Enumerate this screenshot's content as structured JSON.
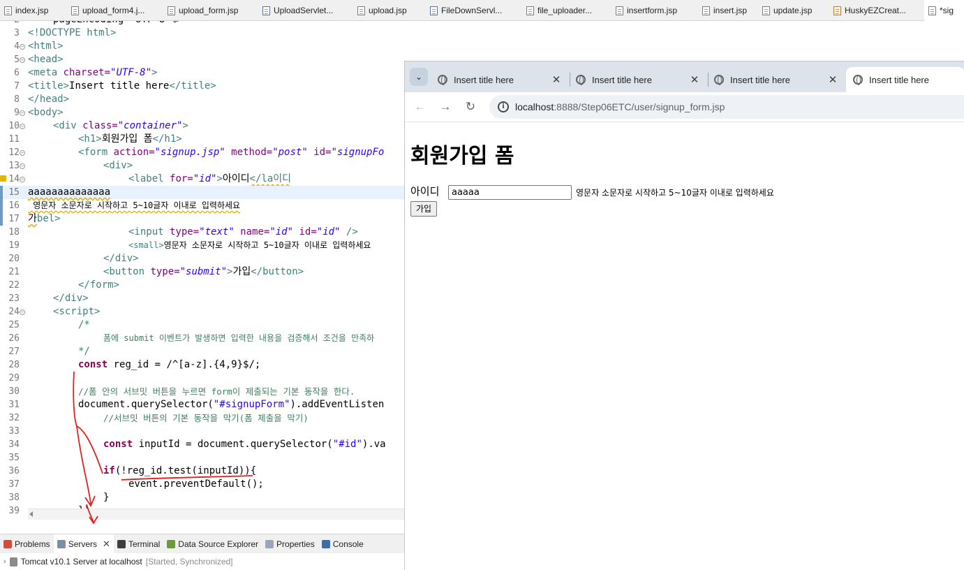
{
  "editor_tabs": [
    {
      "label": "index.jsp",
      "icon": "jsp-file-icon"
    },
    {
      "label": "upload_form4.j...",
      "icon": "jsp-file-icon"
    },
    {
      "label": "upload_form.jsp",
      "icon": "jsp-file-icon"
    },
    {
      "label": "UploadServlet...",
      "icon": "java-file-icon"
    },
    {
      "label": "upload.jsp",
      "icon": "jsp-file-icon"
    },
    {
      "label": "FileDownServl...",
      "icon": "java-file-icon"
    },
    {
      "label": "file_uploader...",
      "icon": "jsp-file-icon"
    },
    {
      "label": "insertform.jsp",
      "icon": "jsp-file-icon"
    },
    {
      "label": "insert.jsp",
      "icon": "jsp-file-icon"
    },
    {
      "label": "update.jsp",
      "icon": "jsp-file-icon"
    },
    {
      "label": "HuskyEZCreat...",
      "icon": "html-file-icon"
    },
    {
      "label": "*sig",
      "icon": "jsp-file-icon"
    }
  ],
  "code": {
    "line_numbers": [
      "2",
      "3",
      "4",
      "5",
      "6",
      "7",
      "8",
      "9",
      "10",
      "11",
      "12",
      "13",
      "14",
      "15",
      "16",
      "17",
      "18",
      "19",
      "20",
      "21",
      "22",
      "23",
      "24",
      "25",
      "26",
      "27",
      "28",
      "29",
      "30",
      "31",
      "32",
      "33",
      "34",
      "35",
      "36",
      "37",
      "38",
      "39"
    ],
    "l2": "pageEncoding=\"UTF-8\"%>",
    "l3": "<!DOCTYPE html>",
    "l4": "<html>",
    "l5": "<head>",
    "l6_tag": "<meta ",
    "l6_attr": "charset=",
    "l6_val": "\"UTF-8\"",
    "l6_end": ">",
    "l7_open": "<title>",
    "l7_text": "Insert title here",
    "l7_close": "</title>",
    "l8": "</head>",
    "l9": "<body>",
    "l10_tag": "<div ",
    "l10_attr": "class=",
    "l10_val": "\"container\"",
    "l10_end": ">",
    "l11_open": "<h1>",
    "l11_text": "회원가입 폼",
    "l11_close": "</h1>",
    "l12_tag": "<form ",
    "l12_attr1": "action=",
    "l12_val1": "\"signup.jsp\"",
    "l12_attr2": " method=",
    "l12_val2": "\"post\"",
    "l12_attr3": " id=",
    "l12_val3": "\"signupFo",
    "l13": "<div>",
    "l14_tag": "<label ",
    "l14_attr": "for=",
    "l14_val": "\"id\"",
    "l14_end": ">",
    "l14_text": "아이디",
    "l14_tail": "</la이디",
    "l15": "aaaaaaaaaaaaaa",
    "l16": " 영문자 소문자로 시작하고 5~10글자 이내로 입력하세요",
    "l17_a": "가",
    "l17_b": "bel>",
    "l18_tag": "<input ",
    "l18_attr1": "type=",
    "l18_val1": "\"text\"",
    "l18_attr2": " name=",
    "l18_val2": "\"id\"",
    "l18_attr3": " id=",
    "l18_val3": "\"id\"",
    "l18_end": " />",
    "l19_open": "<small>",
    "l19_text": "영문자 소문자로 시작하고 5~10글자 이내로 입력하세요",
    "l20": "</div>",
    "l21_tag": "<button ",
    "l21_attr": "type=",
    "l21_val": "\"submit\"",
    "l21_end": ">",
    "l21_text": "가입",
    "l21_close": "</button>",
    "l22": "</form>",
    "l23": "</div>",
    "l24": "<script>",
    "l25": "/*",
    "l26": "폼에 submit 이벤트가 발생하면 입력한 내용을 검증해서 조건을 만족하",
    "l27": "*/",
    "l28_kw": "const",
    "l28_rest": " reg_id = /^[a-z].{4,9}$/;",
    "l29": "",
    "l30": "//폼 안의 서브밋 버튼을 누르면 form이 제출되는 기본 동작을 한다.",
    "l31_a": "document.querySelector(",
    "l31_str": "\"#signupForm\"",
    "l31_b": ").addEventListen",
    "l32": "//서브밋 버튼의 기본 동작을 막기(폼 제출을 막기)",
    "l33": "",
    "l34_kw": "const",
    "l34_a": " inputId = document.querySelector(",
    "l34_str": "\"#id\"",
    "l34_b": ").va",
    "l35": "",
    "l36_kw": "if",
    "l36_rest": "(!reg_id.test(inputId)){",
    "l37": "event.preventDefault();",
    "l38": "}",
    "l39": "})"
  },
  "bottom_views": {
    "tabs": [
      {
        "label": "Problems",
        "icon": "problems-icon"
      },
      {
        "label": "Servers",
        "icon": "servers-icon",
        "close": "✕"
      },
      {
        "label": "Terminal",
        "icon": "terminal-icon"
      },
      {
        "label": "Data Source Explorer",
        "icon": "data-source-icon"
      },
      {
        "label": "Properties",
        "icon": "properties-icon"
      },
      {
        "label": "Console",
        "icon": "console-icon"
      }
    ],
    "server_name": "Tomcat v10.1 Server at localhost",
    "server_status": "[Started, Synchronized]"
  },
  "browser": {
    "tabs": [
      {
        "title": "Insert title here",
        "close": "✕"
      },
      {
        "title": "Insert title here",
        "close": "✕"
      },
      {
        "title": "Insert title here",
        "close": "✕"
      },
      {
        "title": "Insert title here",
        "close": ""
      }
    ],
    "url_host": "localhost",
    "url_rest": ":8888/Step06ETC/user/signup_form.jsp",
    "page": {
      "heading": "회원가입 폼",
      "id_label": "아이디",
      "id_value": "aaaaa",
      "hint": "영문자 소문자로 시작하고 5~10글자 이내로 입력하세요",
      "submit_label": "가입"
    }
  },
  "colors": {
    "tag": "#3f7f7f",
    "attribute": "#7f007f",
    "string": "#2a00ff",
    "keyword": "#7f0055",
    "comment": "#3f7f5f",
    "annotation_ink": "#e02020"
  }
}
